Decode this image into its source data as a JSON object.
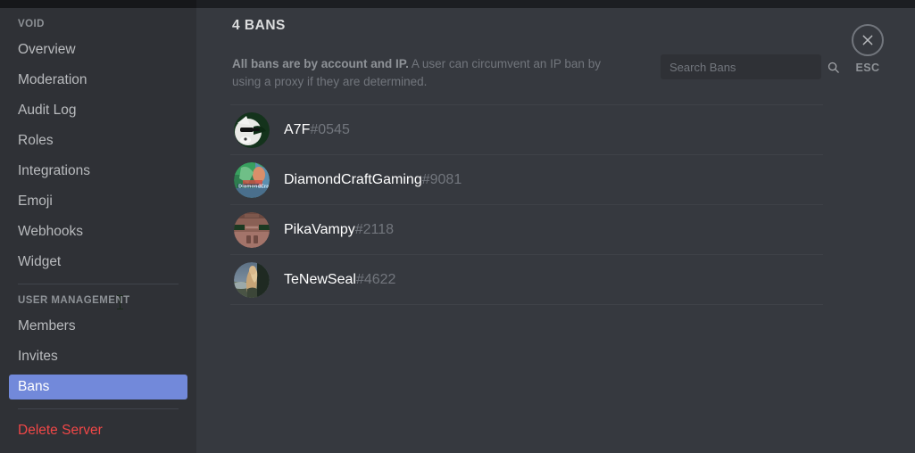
{
  "window": {
    "accent_blurple": "#7289da",
    "danger_red": "#f04747",
    "sidebar_bg": "#2f3136",
    "content_bg": "#36393f"
  },
  "sidebar": {
    "server_name": "VOID",
    "sections": [
      {
        "header": "VOID",
        "items": [
          {
            "label": "Overview",
            "selected": false
          },
          {
            "label": "Moderation",
            "selected": false
          },
          {
            "label": "Audit Log",
            "selected": false
          },
          {
            "label": "Roles",
            "selected": false
          },
          {
            "label": "Integrations",
            "selected": false
          },
          {
            "label": "Emoji",
            "selected": false
          },
          {
            "label": "Webhooks",
            "selected": false
          },
          {
            "label": "Widget",
            "selected": false
          }
        ]
      },
      {
        "header": "USER MANAGEMENT",
        "items": [
          {
            "label": "Members",
            "selected": false
          },
          {
            "label": "Invites",
            "selected": false
          },
          {
            "label": "Bans",
            "selected": true
          }
        ]
      }
    ],
    "delete_server": "Delete Server"
  },
  "main": {
    "title": "4 BANS",
    "ban_count": 4,
    "description_bold": "All bans are by account and IP.",
    "description_rest": " A user can circumvent an IP ban by using a proxy if they are determined."
  },
  "search": {
    "placeholder": "Search Bans",
    "value": "",
    "icon": "search-icon"
  },
  "bans": [
    {
      "username": "A7F",
      "discriminator": "#0545",
      "avatar": "husky-sunglasses"
    },
    {
      "username": "DiamondCraftGaming",
      "discriminator": "#9081",
      "avatar": "green-blue-photo"
    },
    {
      "username": "PikaVampy",
      "discriminator": "#2118",
      "avatar": "brown-minecraft-face"
    },
    {
      "username": "TeNewSeal",
      "discriminator": "#4622",
      "avatar": "person-landscape"
    }
  ],
  "close": {
    "label": "ESC",
    "icon": "close-icon"
  }
}
